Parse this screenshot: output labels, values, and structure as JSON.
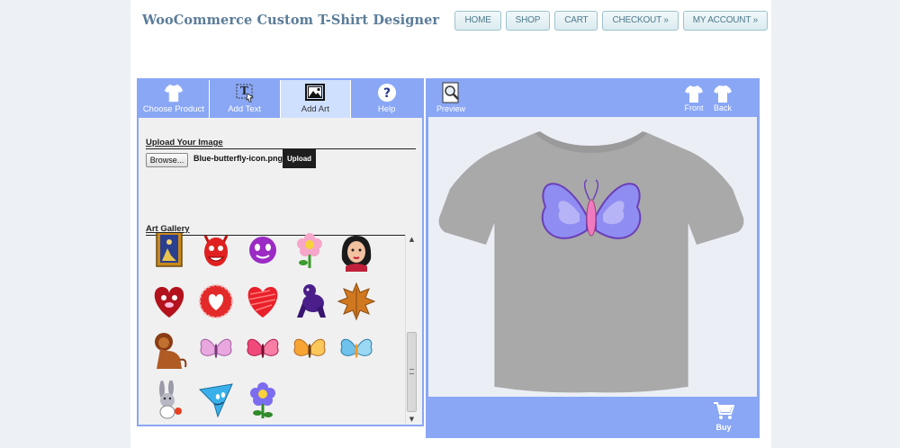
{
  "site": {
    "title": "WooCommerce Custom T-Shirt Designer"
  },
  "nav": [
    "HOME",
    "SHOP",
    "CART",
    "CHECKOUT »",
    "MY ACCOUNT »"
  ],
  "tabs": [
    {
      "label": "Choose Product",
      "icon": "tshirt-icon"
    },
    {
      "label": "Add Text",
      "icon": "text-icon"
    },
    {
      "label": "Add Art",
      "icon": "picture-icon"
    },
    {
      "label": "Help",
      "icon": "help-icon"
    }
  ],
  "active_tab": "Add Art",
  "upload": {
    "title": "Upload Your Image",
    "browse_label": "Browse...",
    "file_name": "Blue-butterfly-icon.png",
    "upload_label": "Upload"
  },
  "gallery": {
    "title": "Art Gallery",
    "items": [
      "picture-frame-art",
      "red-devil-art",
      "purple-face-art",
      "pink-flower-art",
      "girl-face-art",
      "heart-face-art",
      "heart-stamp-art",
      "scribble-heart-art",
      "purple-gorilla-art",
      "autumn-leaf-art",
      "lion-art",
      "pink-butterfly-art",
      "red-butterfly-art",
      "orange-butterfly-art",
      "blue-butterfly-art",
      "rabbit-art",
      "blue-cursor-art",
      "blue-flower-art"
    ]
  },
  "preview": {
    "preview_label": "Preview",
    "front_label": "Front",
    "back_label": "Back",
    "buy_label": "Buy"
  },
  "colors": {
    "panel_blue": "#8aa7f5",
    "active_tab": "#cfe0ff",
    "shirt_gray": "#a9a9a9",
    "butterfly": "#8f8cf2"
  }
}
